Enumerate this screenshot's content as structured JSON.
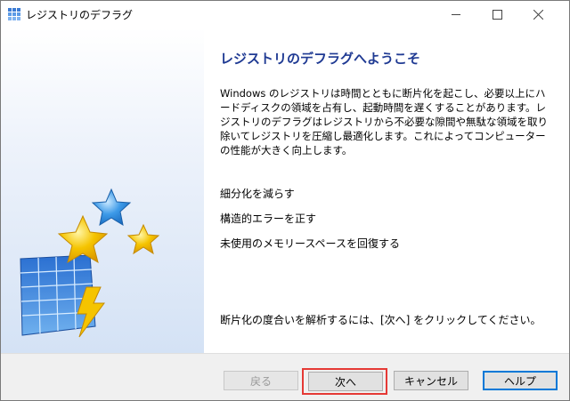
{
  "window": {
    "title": "レジストリのデフラグ",
    "controls": {
      "minimize": "minimize",
      "maximize": "maximize",
      "close": "close"
    }
  },
  "content": {
    "heading": "レジストリのデフラグへようこそ",
    "description": "Windows のレジストリは時間とともに断片化を起こし、必要以上にハードディスクの領域を占有し、起動時間を遅くすることがあります。レジストリのデフラグはレジストリから不必要な隙間や無駄な領域を取り除いてレジストリを圧縮し最適化します。これによってコンピューターの性能が大きく向上します。",
    "bullets": [
      "細分化を減らす",
      "構造的エラーを正す",
      "未使用のメモリースペースを回復する"
    ],
    "instruction": "断片化の度合いを解析するには、[次へ] をクリックしてください。"
  },
  "buttons": {
    "back": "戻る",
    "next": "次へ",
    "cancel": "キャンセル",
    "help": "ヘルプ"
  },
  "colors": {
    "heading": "#1f3a93",
    "highlight": "#e53935",
    "star_gold": "#f5c400",
    "star_blue": "#2f8fe0"
  }
}
